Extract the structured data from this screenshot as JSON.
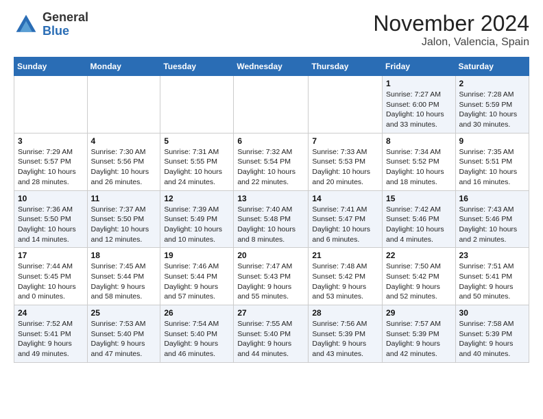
{
  "logo": {
    "general": "General",
    "blue": "Blue"
  },
  "header": {
    "month": "November 2024",
    "location": "Jalon, Valencia, Spain"
  },
  "weekdays": [
    "Sunday",
    "Monday",
    "Tuesday",
    "Wednesday",
    "Thursday",
    "Friday",
    "Saturday"
  ],
  "weeks": [
    [
      {
        "day": "",
        "info": ""
      },
      {
        "day": "",
        "info": ""
      },
      {
        "day": "",
        "info": ""
      },
      {
        "day": "",
        "info": ""
      },
      {
        "day": "",
        "info": ""
      },
      {
        "day": "1",
        "info": "Sunrise: 7:27 AM\nSunset: 6:00 PM\nDaylight: 10 hours\nand 33 minutes."
      },
      {
        "day": "2",
        "info": "Sunrise: 7:28 AM\nSunset: 5:59 PM\nDaylight: 10 hours\nand 30 minutes."
      }
    ],
    [
      {
        "day": "3",
        "info": "Sunrise: 7:29 AM\nSunset: 5:57 PM\nDaylight: 10 hours\nand 28 minutes."
      },
      {
        "day": "4",
        "info": "Sunrise: 7:30 AM\nSunset: 5:56 PM\nDaylight: 10 hours\nand 26 minutes."
      },
      {
        "day": "5",
        "info": "Sunrise: 7:31 AM\nSunset: 5:55 PM\nDaylight: 10 hours\nand 24 minutes."
      },
      {
        "day": "6",
        "info": "Sunrise: 7:32 AM\nSunset: 5:54 PM\nDaylight: 10 hours\nand 22 minutes."
      },
      {
        "day": "7",
        "info": "Sunrise: 7:33 AM\nSunset: 5:53 PM\nDaylight: 10 hours\nand 20 minutes."
      },
      {
        "day": "8",
        "info": "Sunrise: 7:34 AM\nSunset: 5:52 PM\nDaylight: 10 hours\nand 18 minutes."
      },
      {
        "day": "9",
        "info": "Sunrise: 7:35 AM\nSunset: 5:51 PM\nDaylight: 10 hours\nand 16 minutes."
      }
    ],
    [
      {
        "day": "10",
        "info": "Sunrise: 7:36 AM\nSunset: 5:50 PM\nDaylight: 10 hours\nand 14 minutes."
      },
      {
        "day": "11",
        "info": "Sunrise: 7:37 AM\nSunset: 5:50 PM\nDaylight: 10 hours\nand 12 minutes."
      },
      {
        "day": "12",
        "info": "Sunrise: 7:39 AM\nSunset: 5:49 PM\nDaylight: 10 hours\nand 10 minutes."
      },
      {
        "day": "13",
        "info": "Sunrise: 7:40 AM\nSunset: 5:48 PM\nDaylight: 10 hours\nand 8 minutes."
      },
      {
        "day": "14",
        "info": "Sunrise: 7:41 AM\nSunset: 5:47 PM\nDaylight: 10 hours\nand 6 minutes."
      },
      {
        "day": "15",
        "info": "Sunrise: 7:42 AM\nSunset: 5:46 PM\nDaylight: 10 hours\nand 4 minutes."
      },
      {
        "day": "16",
        "info": "Sunrise: 7:43 AM\nSunset: 5:46 PM\nDaylight: 10 hours\nand 2 minutes."
      }
    ],
    [
      {
        "day": "17",
        "info": "Sunrise: 7:44 AM\nSunset: 5:45 PM\nDaylight: 10 hours\nand 0 minutes."
      },
      {
        "day": "18",
        "info": "Sunrise: 7:45 AM\nSunset: 5:44 PM\nDaylight: 9 hours\nand 58 minutes."
      },
      {
        "day": "19",
        "info": "Sunrise: 7:46 AM\nSunset: 5:44 PM\nDaylight: 9 hours\nand 57 minutes."
      },
      {
        "day": "20",
        "info": "Sunrise: 7:47 AM\nSunset: 5:43 PM\nDaylight: 9 hours\nand 55 minutes."
      },
      {
        "day": "21",
        "info": "Sunrise: 7:48 AM\nSunset: 5:42 PM\nDaylight: 9 hours\nand 53 minutes."
      },
      {
        "day": "22",
        "info": "Sunrise: 7:50 AM\nSunset: 5:42 PM\nDaylight: 9 hours\nand 52 minutes."
      },
      {
        "day": "23",
        "info": "Sunrise: 7:51 AM\nSunset: 5:41 PM\nDaylight: 9 hours\nand 50 minutes."
      }
    ],
    [
      {
        "day": "24",
        "info": "Sunrise: 7:52 AM\nSunset: 5:41 PM\nDaylight: 9 hours\nand 49 minutes."
      },
      {
        "day": "25",
        "info": "Sunrise: 7:53 AM\nSunset: 5:40 PM\nDaylight: 9 hours\nand 47 minutes."
      },
      {
        "day": "26",
        "info": "Sunrise: 7:54 AM\nSunset: 5:40 PM\nDaylight: 9 hours\nand 46 minutes."
      },
      {
        "day": "27",
        "info": "Sunrise: 7:55 AM\nSunset: 5:40 PM\nDaylight: 9 hours\nand 44 minutes."
      },
      {
        "day": "28",
        "info": "Sunrise: 7:56 AM\nSunset: 5:39 PM\nDaylight: 9 hours\nand 43 minutes."
      },
      {
        "day": "29",
        "info": "Sunrise: 7:57 AM\nSunset: 5:39 PM\nDaylight: 9 hours\nand 42 minutes."
      },
      {
        "day": "30",
        "info": "Sunrise: 7:58 AM\nSunset: 5:39 PM\nDaylight: 9 hours\nand 40 minutes."
      }
    ]
  ]
}
